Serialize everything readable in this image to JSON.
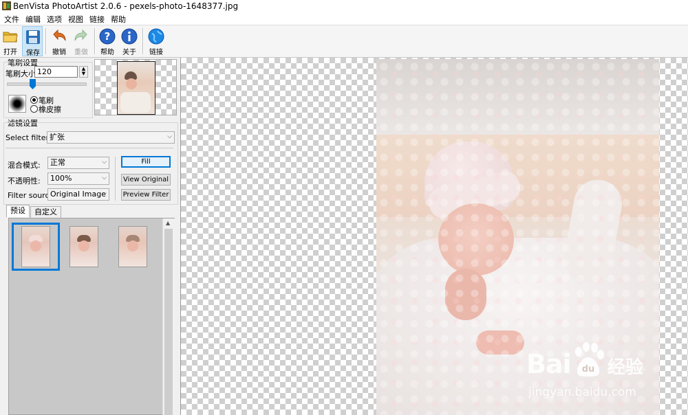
{
  "window": {
    "title": "BenVista PhotoArtist 2.0.6 - pexels-photo-1648377.jpg"
  },
  "menu": [
    "文件",
    "编辑",
    "选项",
    "视图",
    "链接",
    "帮助"
  ],
  "toolbar": {
    "open": "打开",
    "save": "保存",
    "undo": "撤销",
    "redo": "重做",
    "help": "帮助",
    "about": "关于",
    "link": "链接"
  },
  "brush": {
    "group_title": "笔刷设置",
    "size_label": "笔刷大小:",
    "size_value": "120",
    "mode_brush": "笔刷",
    "mode_eraser": "橡皮擦",
    "selected_mode": "笔刷"
  },
  "filter": {
    "group_title": "滤镜设置",
    "select_label": "Select filter:",
    "select_value": "扩张",
    "blend_label": "混合模式:",
    "blend_value": "正常",
    "opacity_label": "不透明性:",
    "opacity_value": "100%",
    "source_label": "Filter source:",
    "source_value": "Original Image",
    "fill_button": "Fill",
    "view_original_button": "View Original",
    "preview_filter_button": "Preview Filter"
  },
  "tabs": {
    "presets": "预设",
    "custom": "自定义",
    "active": "预设"
  },
  "watermark": {
    "brand": "Bai",
    "brand_cn": "经验",
    "url": "jingyan.baidu.com"
  },
  "colors": {
    "accent": "#0078d7",
    "watermark": "#ffffff"
  }
}
